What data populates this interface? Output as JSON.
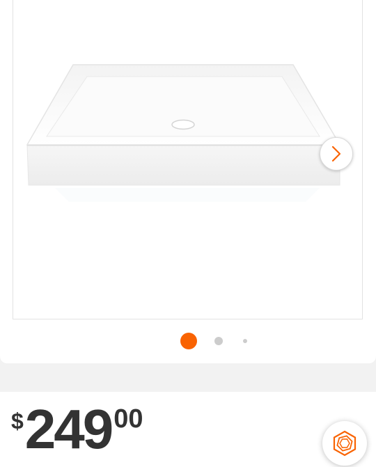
{
  "gallery": {
    "product_image": "white-square-shower-base",
    "next_icon": "chevron-right-icon",
    "pagination": {
      "total": 3,
      "active_index": 0,
      "active_color": "#f96302",
      "inactive_color": "#cccccc"
    }
  },
  "price": {
    "currency_symbol": "$",
    "dollars": "249",
    "cents": "00",
    "color": "#333333"
  },
  "assistant": {
    "icon": "hexagon-logo-icon",
    "color": "#f96302"
  }
}
